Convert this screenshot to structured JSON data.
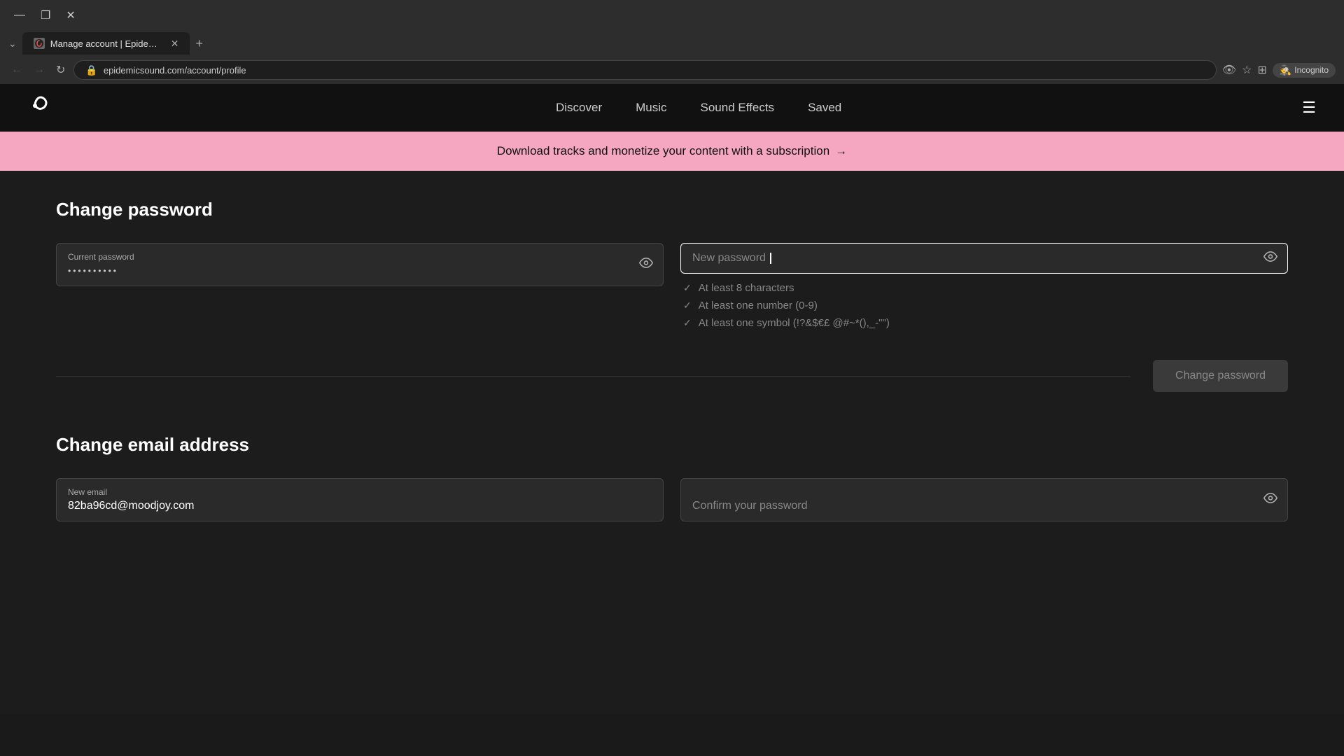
{
  "browser": {
    "tab_title": "Manage account | Epidemic So",
    "tab_favicon": "E",
    "url": "epidemicsound.com/account/profile",
    "incognito_label": "Incognito",
    "new_tab_symbol": "+",
    "window_controls": {
      "minimize": "—",
      "maximize": "❐",
      "close": "✕"
    },
    "nav": {
      "back": "←",
      "forward": "→",
      "refresh": "↻"
    }
  },
  "nav": {
    "logo_symbol": "(",
    "links": [
      {
        "label": "Discover",
        "id": "discover"
      },
      {
        "label": "Music",
        "id": "music"
      },
      {
        "label": "Sound Effects",
        "id": "sound-effects"
      },
      {
        "label": "Saved",
        "id": "saved"
      }
    ],
    "menu_icon": "☰"
  },
  "promo_banner": {
    "text": "Download tracks and monetize your content with a subscription",
    "arrow": "→"
  },
  "change_password": {
    "section_title": "Change password",
    "current_password": {
      "label": "Current password",
      "value_dots": "••••••••••"
    },
    "new_password": {
      "placeholder": "New password"
    },
    "validation": [
      {
        "text": "At least 8 characters",
        "id": "v1"
      },
      {
        "text": "At least one number (0-9)",
        "id": "v2"
      },
      {
        "text": "At least one symbol (!?&$€£ @#~*(),_-\"\")",
        "id": "v3"
      }
    ],
    "submit_button": "Change password"
  },
  "change_email": {
    "section_title": "Change email address",
    "new_email": {
      "label": "New email",
      "value": "82ba96cd@moodjoy.com"
    },
    "confirm_password": {
      "placeholder": "Confirm your password"
    }
  },
  "colors": {
    "accent": "#f5a6c0",
    "background": "#1c1c1c",
    "nav_bg": "#111111",
    "input_bg": "#2a2a2a",
    "button_bg": "#3a3a3a"
  }
}
